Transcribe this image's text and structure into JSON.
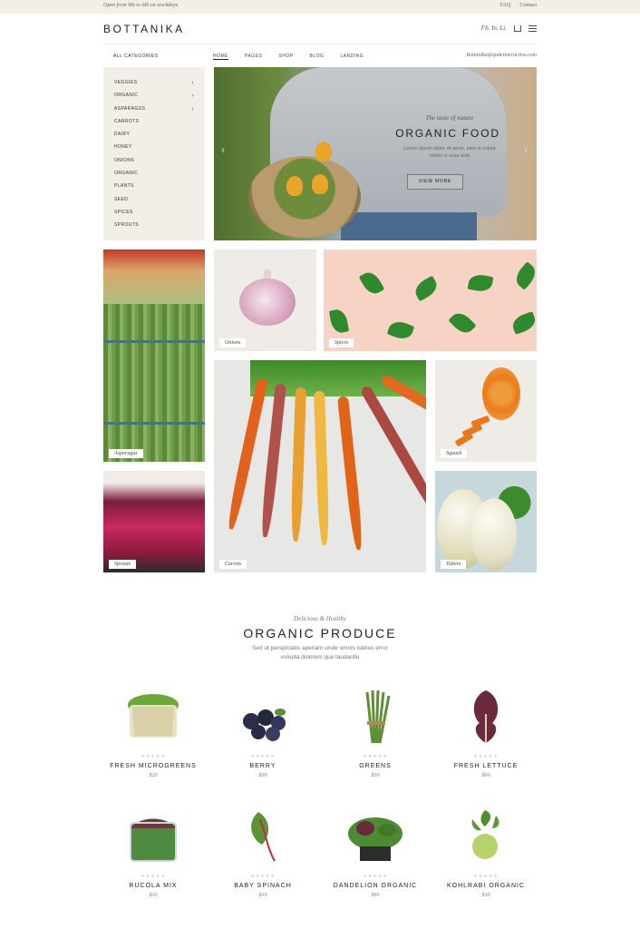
{
  "topbar": {
    "hours": "Open from 9th to 6th on workdays",
    "links": [
      "FAQ",
      "Contact"
    ]
  },
  "header": {
    "logo": "BOTTANIKA",
    "social": "Fb. In. Li."
  },
  "nav": {
    "all_categories": "ALL CATEGORIES",
    "items": [
      "HOME",
      "PAGES",
      "SHOP",
      "BLOG",
      "LANDING"
    ],
    "active": "HOME",
    "email": "Bottanika@qodeinteractive.com"
  },
  "categories": [
    {
      "label": "VEGGIES",
      "has_sub": true
    },
    {
      "label": "ORGANIC",
      "has_sub": true
    },
    {
      "label": "ASPARAGUS",
      "has_sub": true
    },
    {
      "label": "CARROTS",
      "has_sub": false
    },
    {
      "label": "DAIRY",
      "has_sub": false
    },
    {
      "label": "HONEY",
      "has_sub": false
    },
    {
      "label": "ONIONS",
      "has_sub": false
    },
    {
      "label": "ORGANIC",
      "has_sub": false
    },
    {
      "label": "PLANTS",
      "has_sub": false
    },
    {
      "label": "SEED",
      "has_sub": false
    },
    {
      "label": "SPICES",
      "has_sub": false
    },
    {
      "label": "SPROUTS",
      "has_sub": false
    }
  ],
  "hero": {
    "tagline": "The taste of nature",
    "title": "ORGANIC FOOD",
    "desc_line1": "Lorem ipsum dolor sit amet, sam is soluta",
    "desc_line2": "minim w susa dole",
    "button": "VIEW MORE"
  },
  "tiles": {
    "asparagus": "Asparagus",
    "onions": "Onions",
    "spices": "Spices",
    "carrots": "Carrots",
    "squash": "Squash",
    "sprouts": "Sprouts",
    "tubers": "Tubers"
  },
  "produce_section": {
    "tagline": "Delicious & Healthy",
    "title": "ORGANIC PRODUCE",
    "desc_line1": "Sed ut perspiciatis aperiam unde omnis istetus error",
    "desc_line2": "volupta dolorem que laudantiu"
  },
  "products": [
    {
      "name": "FRESH MICROGREENS",
      "price": "$20",
      "rating": 0
    },
    {
      "name": "BERRY",
      "price": "$30",
      "rating": 0
    },
    {
      "name": "GREENS",
      "price": "$30",
      "rating": 0
    },
    {
      "name": "FRESH LETTUCE",
      "price": "$60",
      "rating": 0
    },
    {
      "name": "RUCOLA MIX",
      "price": "$30",
      "rating": 0
    },
    {
      "name": "BABY SPINACH",
      "price": "$10",
      "rating": 0
    },
    {
      "name": "DANDELION ORGANIC",
      "price": "$60",
      "rating": 0
    },
    {
      "name": "KOHLRABI ORGANIC",
      "price": "$30",
      "rating": 0
    }
  ],
  "stars_glyph": "★★★★★",
  "icons": {
    "cart": "cart-icon",
    "menu": "hamburger-icon",
    "chevron": "chevron-right-icon",
    "hero_prev": "arrow-left-icon",
    "hero_next": "arrow-right-icon"
  },
  "colors": {
    "beige": "#f2efe9",
    "text": "#222222",
    "muted": "#777777"
  }
}
